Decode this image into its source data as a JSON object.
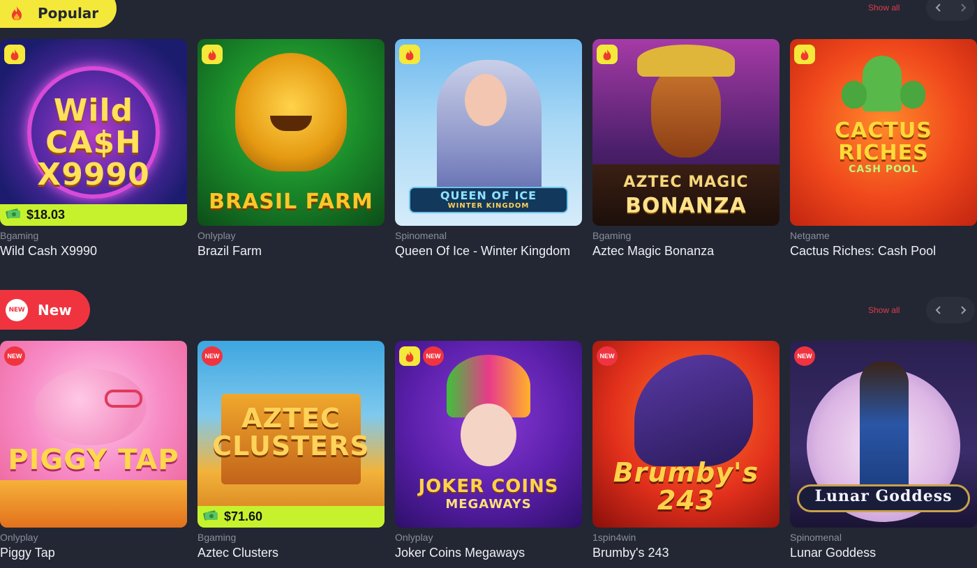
{
  "sections": [
    {
      "title": "Popular",
      "show_all": "Show all",
      "games": [
        {
          "provider": "Bgaming",
          "name": "Wild Cash X9990",
          "art_text": "Wild CA$H X9990",
          "badges": [
            "fire"
          ],
          "jackpot": "$18.03"
        },
        {
          "provider": "Onlyplay",
          "name": "Brazil Farm",
          "art_text": "BRASIL FARM",
          "badges": [
            "fire"
          ],
          "jackpot": null
        },
        {
          "provider": "Spinomenal",
          "name": "Queen Of Ice - Winter Kingdom",
          "art_text": "QUEEN OF ICE",
          "art_sub": "WINTER KINGDOM",
          "badges": [
            "fire"
          ],
          "jackpot": null
        },
        {
          "provider": "Bgaming",
          "name": "Aztec Magic Bonanza",
          "art_text": "AZTEC MAGIC",
          "art_sub": "BONANZA",
          "badges": [
            "fire"
          ],
          "jackpot": null
        },
        {
          "provider": "Netgame",
          "name": "Cactus Riches: Cash Pool",
          "art_text": "CACTUS RICHES",
          "art_sub": "CASH POOL",
          "badges": [
            "fire"
          ],
          "jackpot": null
        }
      ]
    },
    {
      "title": "New",
      "show_all": "Show all",
      "new_label": "NEW",
      "games": [
        {
          "provider": "Onlyplay",
          "name": "Piggy Tap",
          "art_text": "PIGGY TAP",
          "badges": [
            "new"
          ],
          "jackpot": null
        },
        {
          "provider": "Bgaming",
          "name": "Aztec Clusters",
          "art_text": "AZTEC CLUSTERS",
          "badges": [
            "new"
          ],
          "jackpot": "$71.60"
        },
        {
          "provider": "Onlyplay",
          "name": "Joker Coins Megaways",
          "art_text": "JOKER COINS",
          "art_sub": "MEGAWAYS",
          "badges": [
            "fire",
            "new"
          ],
          "jackpot": null
        },
        {
          "provider": "1spin4win",
          "name": "Brumby's 243",
          "art_text": "Brumby's 243",
          "badges": [
            "new"
          ],
          "jackpot": null
        },
        {
          "provider": "Spinomenal",
          "name": "Lunar Goddess",
          "art_text": "Lunar Goddess",
          "badges": [
            "new"
          ],
          "jackpot": null
        }
      ]
    }
  ],
  "icons": {
    "fire": "fire-icon",
    "new": "new-badge",
    "money": "money-icon",
    "prev": "chevron-left-icon",
    "next": "chevron-right-icon"
  },
  "colors": {
    "background": "#222733",
    "popular_accent": "#f4e83a",
    "new_accent": "#ef3440",
    "jackpot": "#c6f22d",
    "show_all": "#e23c4a"
  }
}
